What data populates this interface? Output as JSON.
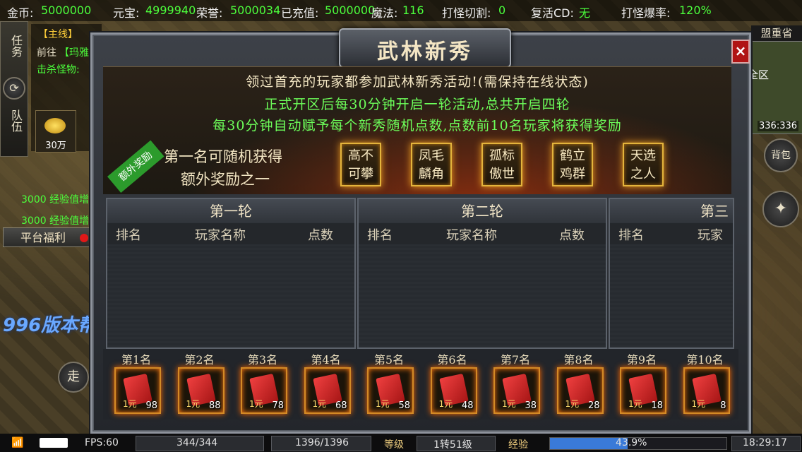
{
  "topbar": {
    "gold_label": "金币:",
    "gold_value": "5000000",
    "yuanbao_label": "元宝:",
    "yuanbao_value": "4999940",
    "honor_label": "荣誉:",
    "honor_value": "5000034",
    "recharged_label": "已充值:",
    "recharged_value": "5000000",
    "magic_label": "魔法:",
    "magic_value": "116",
    "cut_label": "打怪切割:",
    "cut_value": "0",
    "revive_label": "复活CD:",
    "revive_value": "无",
    "droprate_label": "打怪爆率:",
    "droprate_value": "120%"
  },
  "leftnav": {
    "task": "任务",
    "team": "队伍"
  },
  "quest": {
    "tag": "【主线】",
    "line2_prefix": "前往",
    "line2_link": "【玛雅",
    "line3": "击杀怪物:",
    "reward_amount": "30万"
  },
  "messages": [
    "3000 经验值增加.",
    "3000 经验值增加."
  ],
  "platform_button": "平台福利",
  "walk_button": "走",
  "right": {
    "map": "盟重省",
    "all": "全区",
    "coords": "336:336",
    "bag": "背包"
  },
  "dialog": {
    "title": "武林新秀",
    "close": "×",
    "intro": [
      "领过首充的玩家都参加武林新秀活动!(需保持在线状态)",
      "正式开区后每30分钟开启一轮活动,总共开启四轮",
      "每30分钟自动赋予每个新秀随机点数,点数前10名玩家将获得奖励"
    ],
    "ribbon": "额外奖励",
    "extra_line1": "第一名可随机获得",
    "extra_line2": "额外奖励之一",
    "titles": [
      {
        "a": "高不",
        "b": "可攀"
      },
      {
        "a": "凤毛",
        "b": "麟角"
      },
      {
        "a": "孤标",
        "b": "傲世"
      },
      {
        "a": "鹤立",
        "b": "鸡群"
      },
      {
        "a": "天选",
        "b": "之人"
      }
    ],
    "rounds": [
      {
        "name": "第一轮",
        "rank": "排名",
        "player": "玩家名称",
        "points": "点数"
      },
      {
        "name": "第二轮",
        "rank": "排名",
        "player": "玩家名称",
        "points": "点数"
      },
      {
        "name": "第三",
        "rank": "排名",
        "player": "玩家",
        "points": ""
      }
    ],
    "rewards": [
      {
        "place": "第1名",
        "count": "98"
      },
      {
        "place": "第2名",
        "count": "88"
      },
      {
        "place": "第3名",
        "count": "78"
      },
      {
        "place": "第4名",
        "count": "68"
      },
      {
        "place": "第5名",
        "count": "58"
      },
      {
        "place": "第6名",
        "count": "48"
      },
      {
        "place": "第7名",
        "count": "38"
      },
      {
        "place": "第8名",
        "count": "28"
      },
      {
        "place": "第9名",
        "count": "18"
      },
      {
        "place": "第10名",
        "count": "8"
      }
    ],
    "reward_item_label": "1元"
  },
  "bottombar": {
    "fps": "FPS:60",
    "hp": "344/344",
    "mp": "1396/1396",
    "level_label": "等级",
    "level_value": "1转51级",
    "exp_label": "经验",
    "exp_value": "43.9%",
    "exp_fraction": 0.439,
    "time": "18:29:17"
  },
  "watermark": "996版本帮"
}
